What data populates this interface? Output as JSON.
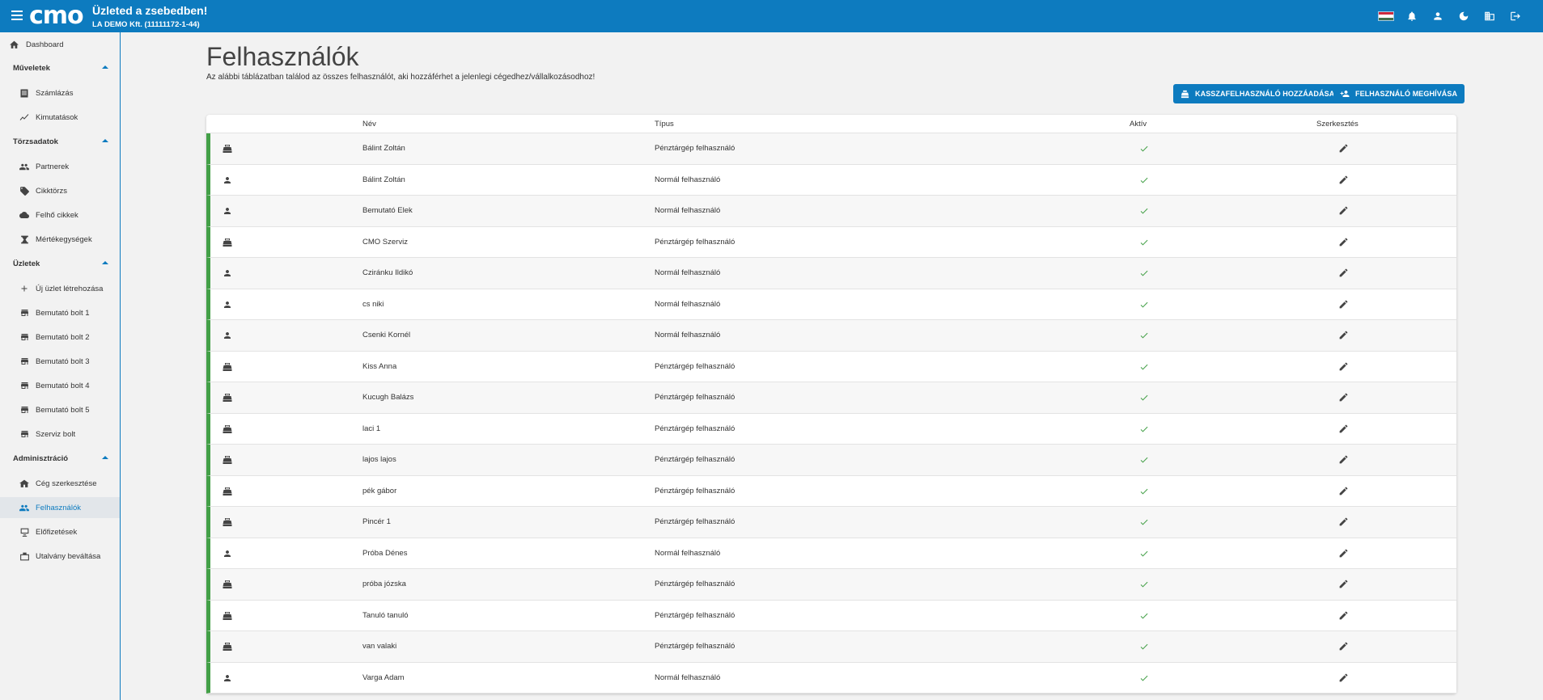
{
  "header": {
    "logo": "cmo",
    "tagline": "Üzleted a zsebedben!",
    "company": "LA DEMO Kft. (11111172-1-44)"
  },
  "sidebar": {
    "dashboard": "Dashboard",
    "muveletek": "Műveletek",
    "szamlazas": "Számlázás",
    "kimutatasok": "Kimutatások",
    "torzsadatok": "Törzsadatok",
    "partnerek": "Partnerek",
    "cikktorzs": "Cikktörzs",
    "felho_cikkek": "Felhő cikkek",
    "mertekegysegek": "Mértékegységek",
    "uzletek": "Üzletek",
    "uj_uzlet": "Új üzlet létrehozása",
    "bolt1": "Bemutató bolt 1",
    "bolt2": "Bemutató bolt 2",
    "bolt3": "Bemutató bolt 3",
    "bolt4": "Bemutató bolt 4",
    "bolt5": "Bemutató bolt 5",
    "szerviz_bolt": "Szerviz bolt",
    "adminisztracio": "Adminisztráció",
    "ceg_szerkesztese": "Cég szerkesztése",
    "felhasznalok": "Felhasználók",
    "elofizetesek": "Előfizetések",
    "utalvany": "Utalvány beváltása"
  },
  "main": {
    "title": "Felhasználók",
    "description": "Az alábbi táblázatban találod az összes felhasználót, aki hozzáférhet a jelenlegi cégedhez/vállalkozásodhoz!",
    "btn_add_cashier": "Kasszafelhasználó hozzáadása",
    "btn_invite_user": "Felhasználó meghívása"
  },
  "table": {
    "headers": {
      "name": "Név",
      "type": "Típus",
      "active": "Aktív",
      "edit": "Szerkesztés"
    },
    "rows": [
      {
        "kind": "register",
        "name": "Bálint Zoltán",
        "type": "Pénztárgép felhasználó",
        "active": true
      },
      {
        "kind": "person",
        "name": "Bálint Zoltán",
        "type": "Normál felhasználó",
        "active": true
      },
      {
        "kind": "person",
        "name": "Bemutató Elek",
        "type": "Normál felhasználó",
        "active": true
      },
      {
        "kind": "register",
        "name": "CMO Szerviz",
        "type": "Pénztárgép felhasználó",
        "active": true
      },
      {
        "kind": "person",
        "name": "Cziránku Ildikó",
        "type": "Normál felhasználó",
        "active": true
      },
      {
        "kind": "person",
        "name": "cs niki",
        "type": "Normál felhasználó",
        "active": true
      },
      {
        "kind": "person",
        "name": "Csenki Kornél",
        "type": "Normál felhasználó",
        "active": true
      },
      {
        "kind": "register",
        "name": "Kiss Anna",
        "type": "Pénztárgép felhasználó",
        "active": true
      },
      {
        "kind": "register",
        "name": "Kucugh Balázs",
        "type": "Pénztárgép felhasználó",
        "active": true
      },
      {
        "kind": "register",
        "name": "laci 1",
        "type": "Pénztárgép felhasználó",
        "active": true
      },
      {
        "kind": "register",
        "name": "lajos lajos",
        "type": "Pénztárgép felhasználó",
        "active": true
      },
      {
        "kind": "register",
        "name": "pék gábor",
        "type": "Pénztárgép felhasználó",
        "active": true
      },
      {
        "kind": "register",
        "name": "Pincér 1",
        "type": "Pénztárgép felhasználó",
        "active": true
      },
      {
        "kind": "person",
        "name": "Próba Dénes",
        "type": "Normál felhasználó",
        "active": true
      },
      {
        "kind": "register",
        "name": "próba józska",
        "type": "Pénztárgép felhasználó",
        "active": true
      },
      {
        "kind": "register",
        "name": "Tanuló tanuló",
        "type": "Pénztárgép felhasználó",
        "active": true
      },
      {
        "kind": "register",
        "name": "van valaki",
        "type": "Pénztárgép felhasználó",
        "active": true
      },
      {
        "kind": "person",
        "name": "Varga Adam",
        "type": "Normál felhasználó",
        "active": true
      }
    ]
  },
  "colors": {
    "brand": "#0d7bbf",
    "active_bar": "#43a047",
    "check": "#43a047"
  }
}
